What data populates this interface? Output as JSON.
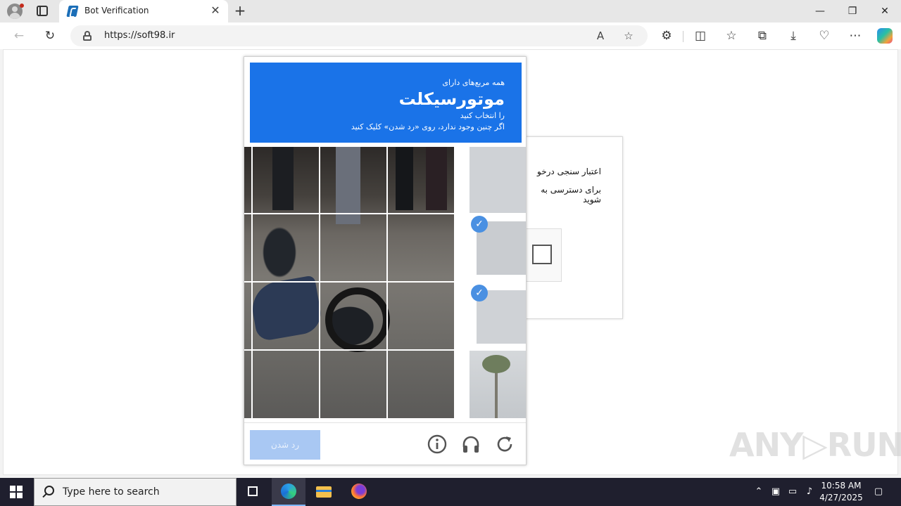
{
  "browser": {
    "tab_title": "Bot Verification",
    "tab_close": "✕",
    "new_tab": "+",
    "window_controls": {
      "minimize": "—",
      "restore": "❐",
      "close": "✕"
    },
    "url": "https://soft98.ir",
    "nav_icons": [
      "back-icon",
      "refresh-icon"
    ],
    "address_icons": [
      "read-aloud-icon",
      "favorite-star-icon"
    ],
    "toolbar_icons": [
      "extensions-icon",
      "split-screen-icon",
      "favorites-icon",
      "collections-icon",
      "downloads-icon",
      "browser-essentials-icon",
      "more-menu-icon",
      "copilot-icon"
    ]
  },
  "verify_card": {
    "line1": "اعتبار سنجی درخو",
    "line2": "برای دسترسی به",
    "line3": "شوید"
  },
  "captcha": {
    "header_line1": "همه مربع‌های دارای",
    "header_target": "موتورسیکلت",
    "header_line3": "را انتخاب کنید",
    "header_line4": "اگر چنین وجود ندارد، روی «رد شدن» کلیک کنید",
    "skip_label": "رد شدن",
    "accent_color": "#1a73e8",
    "footer_icons": [
      "info-icon",
      "audio-headphones-icon",
      "reload-icon"
    ],
    "selected_check": "✓"
  },
  "watermark": "ANY▷RUN",
  "taskbar": {
    "search_placeholder": "Type here to search",
    "time": "10:58 AM",
    "date": "4/27/2025",
    "pinned": [
      "task-view-icon",
      "edge-icon",
      "file-explorer-icon",
      "firefox-icon"
    ],
    "tray_icons": [
      "chevron-up-icon",
      "meet-now-icon",
      "network-icon",
      "volume-icon",
      "notification-icon"
    ]
  }
}
